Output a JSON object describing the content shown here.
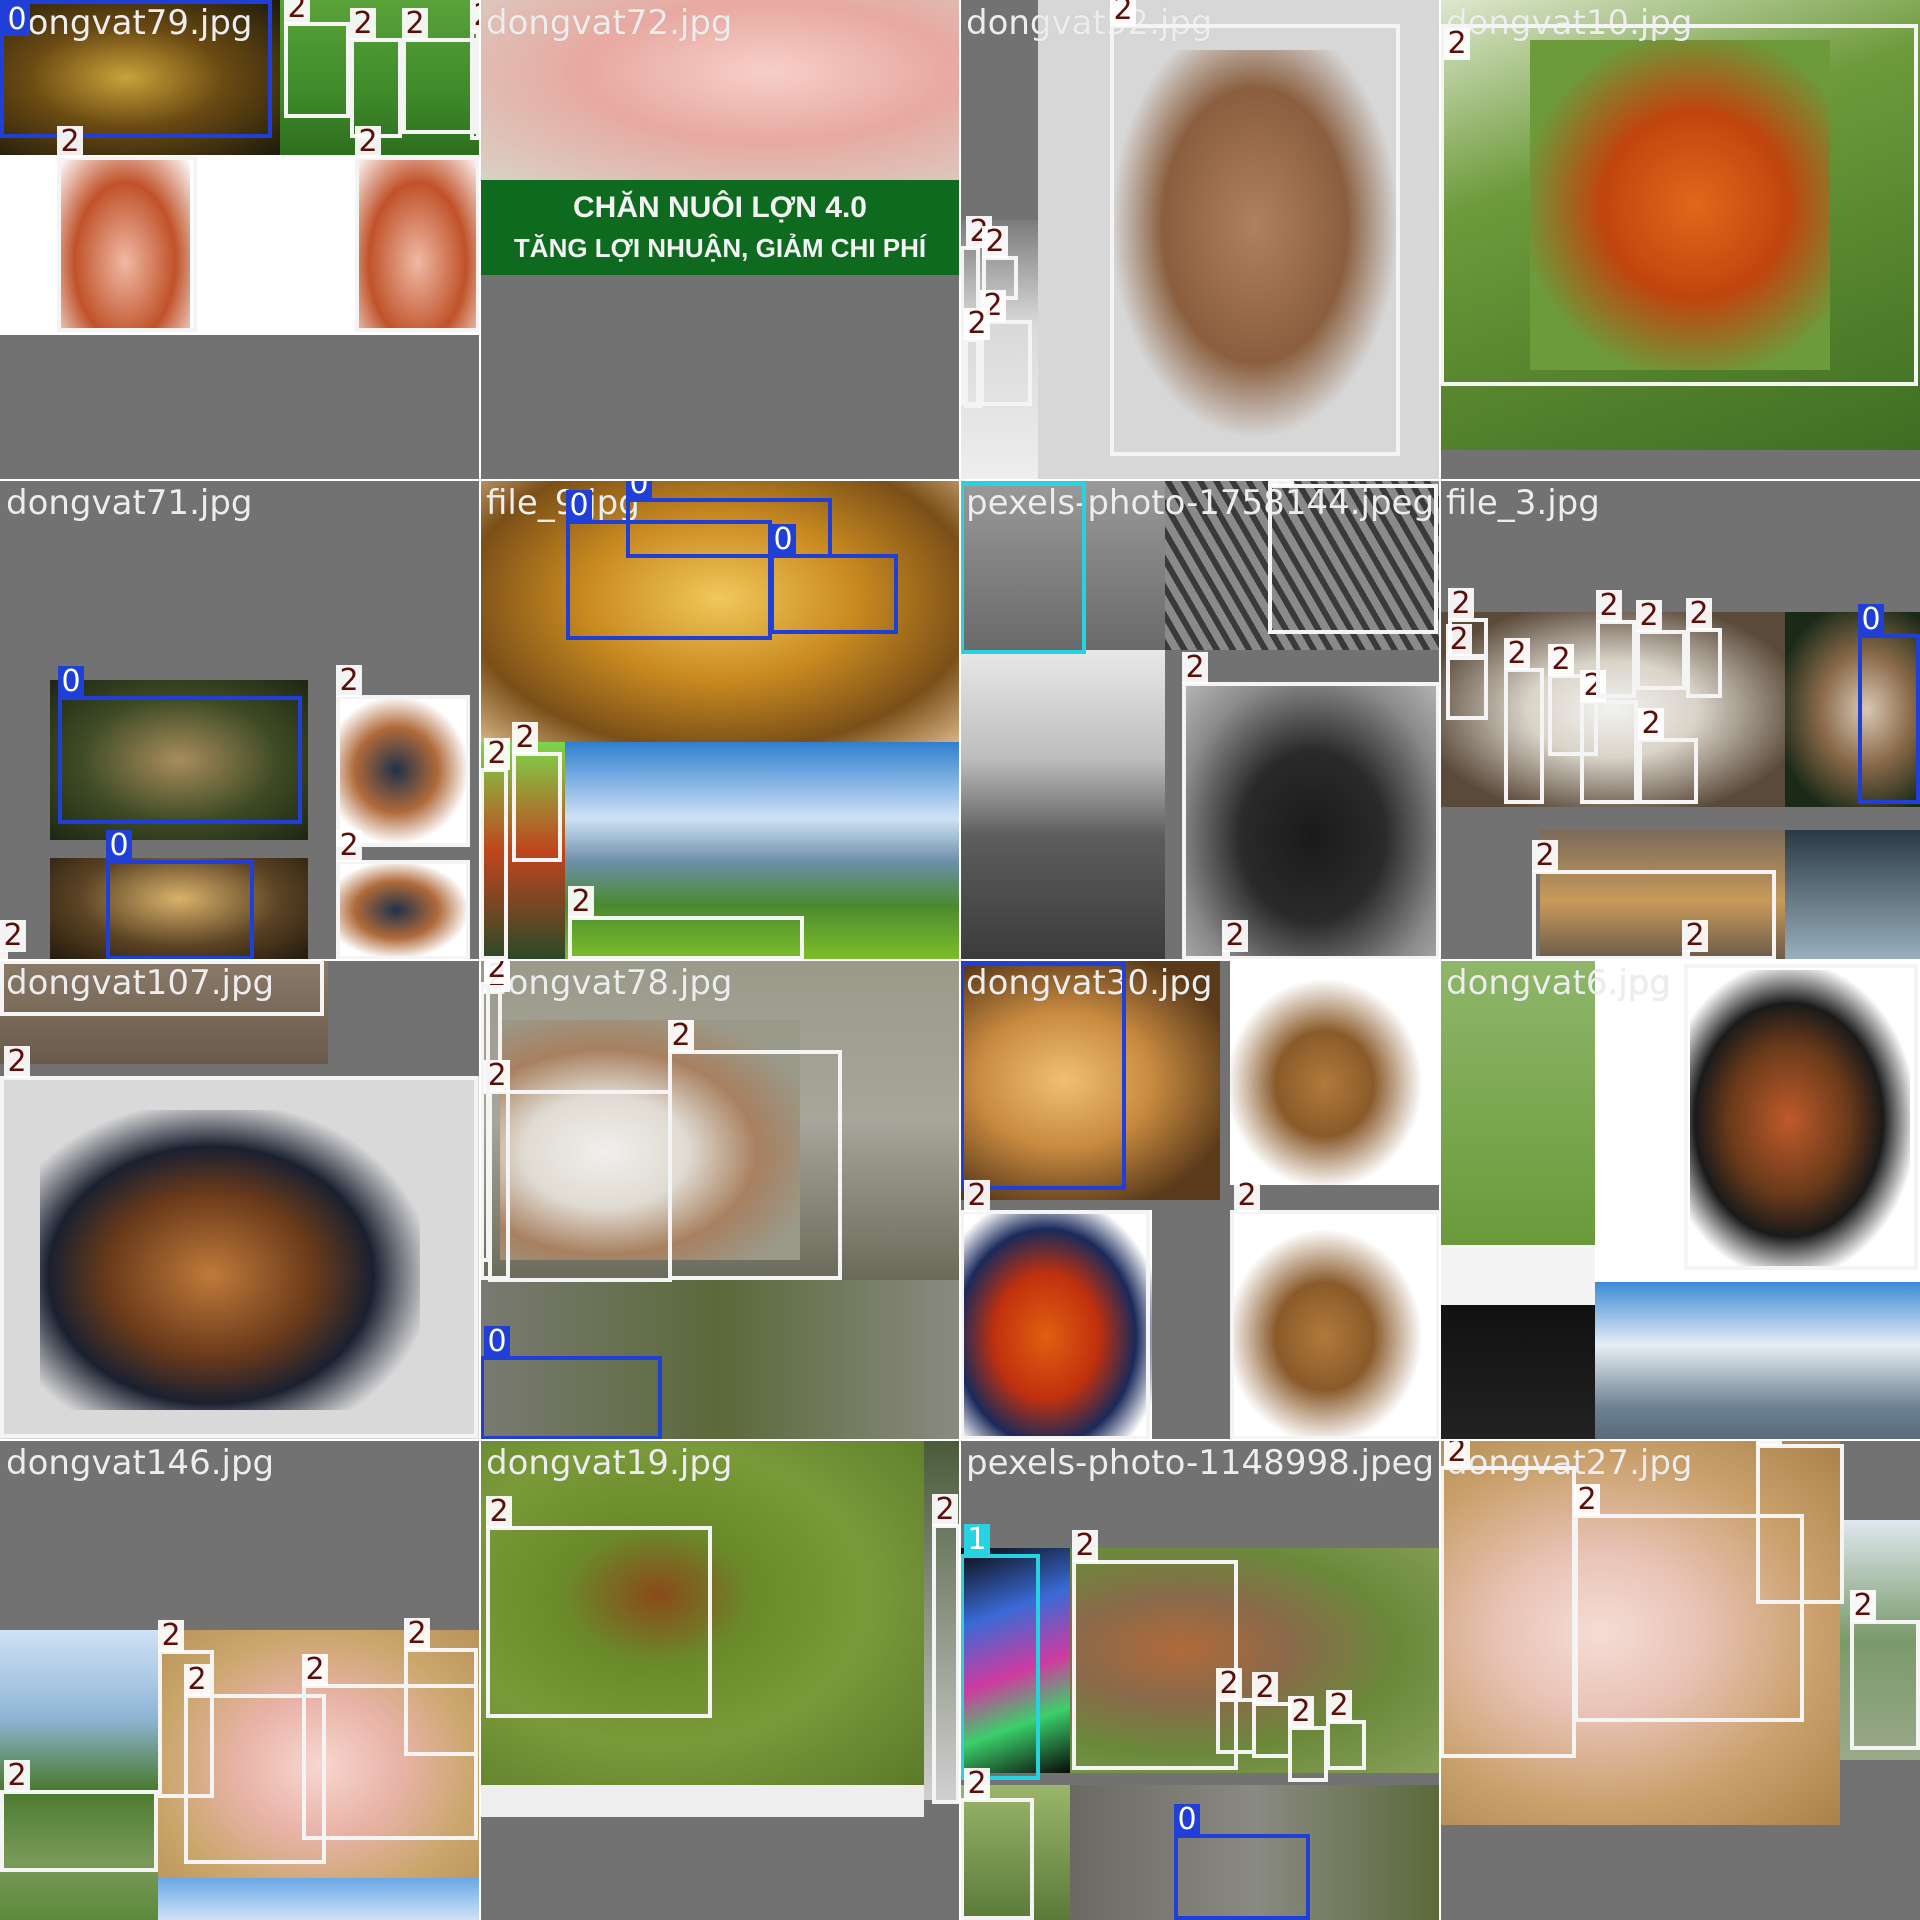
{
  "mosaic": {
    "tiles": [
      {
        "filename": "dongvat79.jpg",
        "labels": [
          "0",
          "2",
          "2",
          "2",
          "2",
          "2",
          "2"
        ]
      },
      {
        "filename": "dongvat72.jpg",
        "labels": [],
        "banner_line1": "CHĂN NUÔI LỢN 4.0",
        "banner_line2": "TĂNG LỢI NHUẬN, GIẢM CHI PHÍ"
      },
      {
        "filename": "dongvat52.jpg",
        "labels": [
          "2",
          "2",
          "2",
          "2",
          "2"
        ]
      },
      {
        "filename": "dongvat10.jpg",
        "labels": [
          "2"
        ]
      },
      {
        "filename": "dongvat71.jpg",
        "labels": [
          "0",
          "0",
          "2",
          "2",
          "2"
        ]
      },
      {
        "filename": "file_9.jpg",
        "labels": [
          "0",
          "0",
          "0",
          "2",
          "2",
          "2"
        ]
      },
      {
        "filename": "pexels-photo-1758144.jpeg",
        "labels": [
          "1",
          "2",
          "2",
          "2"
        ]
      },
      {
        "filename": "file_3.jpg",
        "labels": [
          "2",
          "2",
          "2",
          "2",
          "2",
          "2",
          "2",
          "2",
          "2",
          "0",
          "2",
          "2"
        ]
      },
      {
        "filename": "dongvat107.jpg",
        "labels": [
          "2"
        ]
      },
      {
        "filename": "dongvat78.jpg",
        "labels": [
          "2",
          "2",
          "2",
          "2",
          "0"
        ]
      },
      {
        "filename": "dongvat30.jpg",
        "labels": [
          "0",
          "2",
          "2"
        ]
      },
      {
        "filename": "dongvat6.jpg",
        "labels": [
          "2"
        ]
      },
      {
        "filename": "dongvat146.jpg",
        "labels": [
          "2",
          "2",
          "2",
          "2",
          "2"
        ]
      },
      {
        "filename": "dongvat19.jpg",
        "labels": [
          "2",
          "2"
        ]
      },
      {
        "filename": "pexels-photo-1148998.jpeg",
        "labels": [
          "1",
          "2",
          "2",
          "2",
          "2",
          "2",
          "2",
          "0"
        ]
      },
      {
        "filename": "dongvat27.jpg",
        "labels": [
          "2",
          "2",
          "2",
          "2"
        ]
      }
    ],
    "class_colors": {
      "0": "#1f3fd6",
      "1": "#27d3e0",
      "2": "#f4f4f4"
    },
    "label_text_color": "#5b0f0a",
    "pad_color": "#727272"
  }
}
